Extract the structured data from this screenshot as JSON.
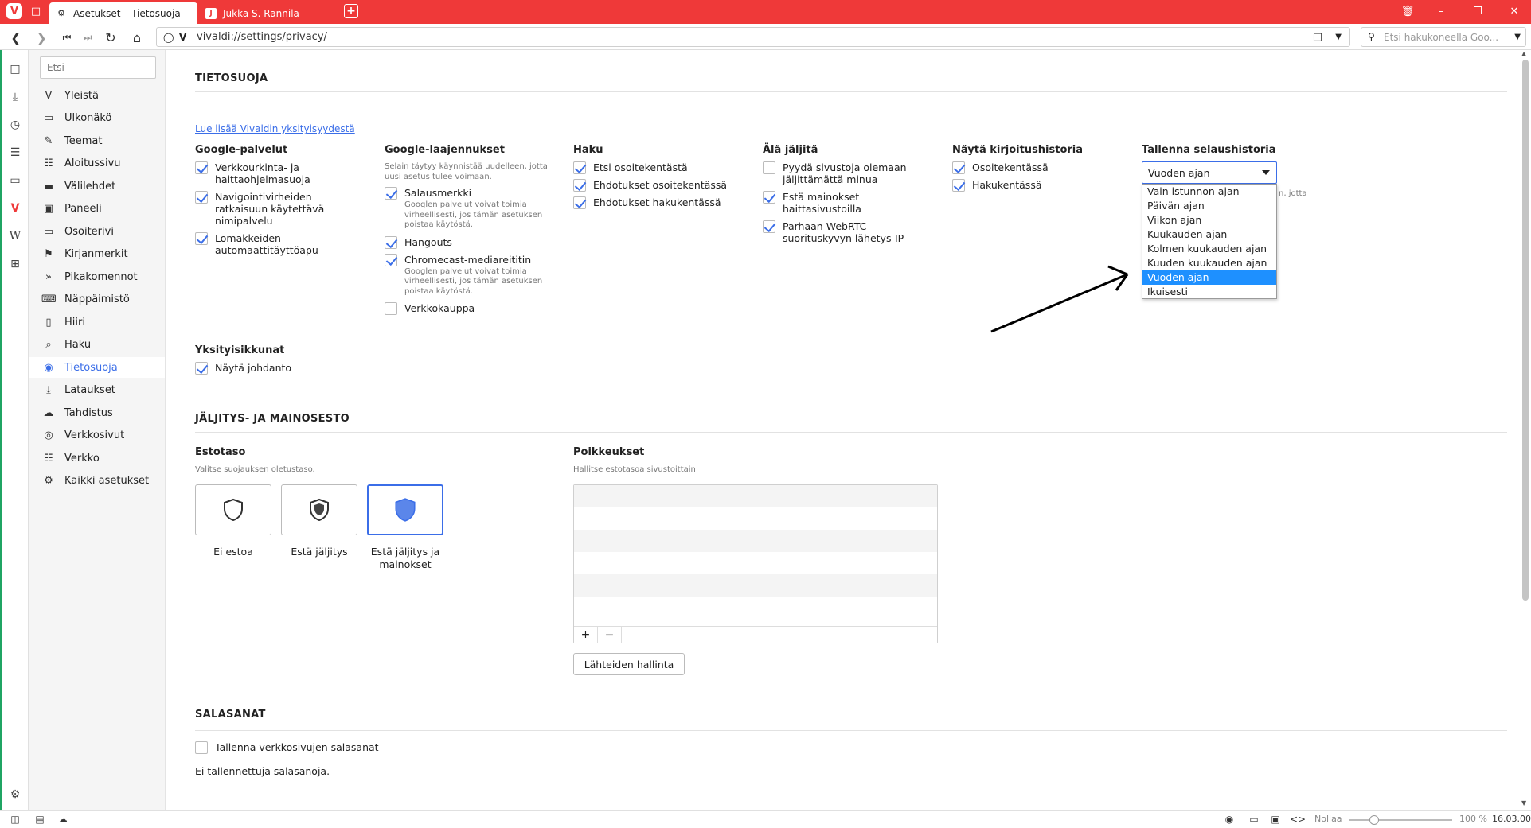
{
  "tabs": [
    {
      "label": "Asetukset – Tietosuoja"
    },
    {
      "label": "Jukka S. Rannila"
    }
  ],
  "address": {
    "url": "vivaldi://settings/privacy/",
    "search_placeholder": "Etsi hakukoneella Goo..."
  },
  "nav": {
    "search_placeholder": "Etsi",
    "items": [
      {
        "label": "Yleistä",
        "icon": "vivaldi-v-icon"
      },
      {
        "label": "Ulkonäkö",
        "icon": "folder-icon"
      },
      {
        "label": "Teemat",
        "icon": "brush-icon"
      },
      {
        "label": "Aloitussivu",
        "icon": "grid-icon"
      },
      {
        "label": "Välilehdet",
        "icon": "tabs-icon"
      },
      {
        "label": "Paneeli",
        "icon": "panel-icon"
      },
      {
        "label": "Osoiterivi",
        "icon": "address-bar-icon"
      },
      {
        "label": "Kirjanmerkit",
        "icon": "bookmark-icon"
      },
      {
        "label": "Pikakomennot",
        "icon": "quick-command-icon"
      },
      {
        "label": "Näppäimistö",
        "icon": "keyboard-icon"
      },
      {
        "label": "Hiiri",
        "icon": "mouse-icon"
      },
      {
        "label": "Haku",
        "icon": "search-icon"
      },
      {
        "label": "Tietosuoja",
        "icon": "eye-icon"
      },
      {
        "label": "Lataukset",
        "icon": "download-icon"
      },
      {
        "label": "Tahdistus",
        "icon": "cloud-icon"
      },
      {
        "label": "Verkkosivut",
        "icon": "globe-icon"
      },
      {
        "label": "Verkko",
        "icon": "network-icon"
      },
      {
        "label": "Kaikki asetukset",
        "icon": "gear-icon"
      }
    ]
  },
  "privacy": {
    "title": "TIETOSUOJA",
    "learn_more": "Lue lisää Vivaldin yksityisyydestä",
    "google_services": {
      "title": "Google-palvelut",
      "items": [
        {
          "label": "Verkkourkinta- ja haittaohjelmasuoja",
          "checked": true
        },
        {
          "label": "Navigointivirheiden ratkaisuun käytettävä nimipalvelu",
          "checked": true
        },
        {
          "label": "Lomakkeiden automaattitäyttöapu",
          "checked": true
        }
      ]
    },
    "google_extensions": {
      "title": "Google-laajennukset",
      "desc": "Selain täytyy käynnistää uudelleen, jotta uusi asetus tulee voimaan.",
      "items": [
        {
          "label": "Salausmerkki",
          "sub": "Googlen palvelut voivat toimia virheellisesti, jos tämän asetuksen poistaa käytöstä.",
          "checked": true
        },
        {
          "label": "Hangouts",
          "sub": "",
          "checked": true
        },
        {
          "label": "Chromecast-mediareititin",
          "sub": "Googlen palvelut voivat toimia virheellisesti, jos tämän asetuksen poistaa käytöstä.",
          "checked": true
        },
        {
          "label": "Verkkokauppa",
          "sub": "",
          "checked": false
        }
      ]
    },
    "search": {
      "title": "Haku",
      "items": [
        {
          "label": "Etsi osoitekentästä",
          "checked": true
        },
        {
          "label": "Ehdotukset osoitekentässä",
          "checked": true
        },
        {
          "label": "Ehdotukset hakukentässä",
          "checked": true
        }
      ]
    },
    "do_not_track": {
      "title": "Älä jäljitä",
      "items": [
        {
          "label": "Pyydä sivustoja olemaan jäljittämättä minua",
          "checked": false
        },
        {
          "label": "Estä mainokset haittasivustoilla",
          "checked": true
        },
        {
          "label": "Parhaan WebRTC-suorituskyvyn lähetys-IP",
          "checked": true
        }
      ]
    },
    "typed_history": {
      "title": "Näytä kirjoitushistoria",
      "items": [
        {
          "label": "Osoitekentässä",
          "checked": true
        },
        {
          "label": "Hakukentässä",
          "checked": true
        }
      ]
    },
    "save_history": {
      "title": "Tallenna selaushistoria",
      "selected": "Vuoden ajan",
      "partial_desc": "n, jotta",
      "options": [
        "Vain istunnon ajan",
        "Päivän ajan",
        "Viikon ajan",
        "Kuukauden ajan",
        "Kolmen kuukauden ajan",
        "Kuuden kuukauden ajan",
        "Vuoden ajan",
        "Ikuisesti"
      ],
      "selected_index": 6
    },
    "private_windows": {
      "title": "Yksityisikkunat",
      "items": [
        {
          "label": "Näytä johdanto",
          "checked": true
        }
      ]
    }
  },
  "tracking": {
    "title": "JÄLJITYS- JA MAINOSESTO",
    "level_title": "Estotaso",
    "level_desc": "Valitse suojauksen oletustaso.",
    "levels": [
      {
        "label": "Ei estoa",
        "icon": "shield-outline-icon"
      },
      {
        "label": "Estä jäljitys",
        "icon": "shield-half-icon"
      },
      {
        "label": "Estä jäljitys ja mainokset",
        "icon": "shield-full-icon"
      }
    ],
    "exceptions_title": "Poikkeukset",
    "exceptions_desc": "Hallitse estotasoa sivustoittain",
    "add_label": "+",
    "remove_label": "−",
    "sources_button": "Lähteiden hallinta"
  },
  "passwords": {
    "title": "SALASANAT",
    "save_label": "Tallenna verkkosivujen salasanat",
    "empty_text": "Ei tallennettuja salasanoja."
  },
  "statusbar": {
    "reset_label": "Nollaa",
    "zoom": "100 %",
    "time": "16.03.00"
  },
  "colors": {
    "brand": "#ef3939",
    "accent": "#3b6ee8",
    "selection": "#1e90ff"
  }
}
